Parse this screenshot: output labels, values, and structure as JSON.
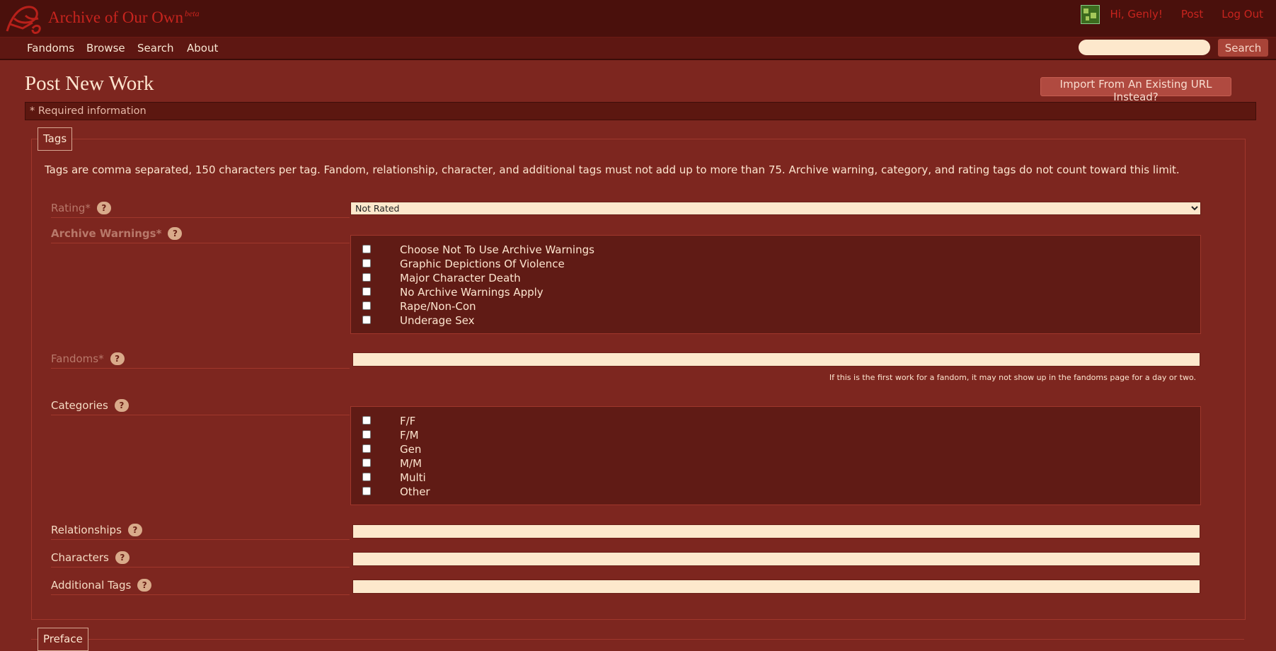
{
  "header": {
    "site_title": "Archive of Our Own",
    "beta": "beta",
    "greeting": "Hi, Genly!",
    "post": "Post",
    "logout": "Log Out"
  },
  "nav": {
    "items": [
      "Fandoms",
      "Browse",
      "Search",
      "About"
    ],
    "search_button": "Search",
    "search_placeholder": ""
  },
  "page": {
    "title": "Post New Work",
    "import_button": "Import From An Existing URL Instead?",
    "required_note": "* Required information"
  },
  "tags": {
    "legend": "Tags",
    "note": "Tags are comma separated, 150 characters per tag. Fandom, relationship, character, and additional tags must not add up to more than 75. Archive warning, category, and rating tags do not count toward this limit.",
    "rating_label": "Rating*",
    "rating_value": "Not Rated",
    "warnings_label": "Archive Warnings*",
    "warnings": [
      "Choose Not To Use Archive Warnings",
      "Graphic Depictions Of Violence",
      "Major Character Death",
      "No Archive Warnings Apply",
      "Rape/Non-Con",
      "Underage Sex"
    ],
    "fandoms_label": "Fandoms*",
    "fandoms_hint": "If this is the first work for a fandom, it may not show up in the fandoms page for a day or two.",
    "categories_label": "Categories",
    "categories": [
      "F/F",
      "F/M",
      "Gen",
      "M/M",
      "Multi",
      "Other"
    ],
    "relationships_label": "Relationships",
    "characters_label": "Characters",
    "additional_label": "Additional Tags",
    "help_symbol": "?"
  },
  "preface": {
    "legend": "Preface"
  },
  "colors": {
    "background": "#7d261f",
    "header": "#4a100c",
    "link_red": "#c8241e",
    "input_bg": "#fde8cc"
  }
}
